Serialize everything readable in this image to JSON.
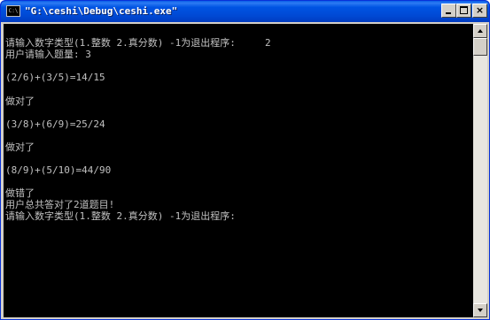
{
  "window": {
    "title": "\"G:\\ceshi\\Debug\\ceshi.exe\"",
    "icon_label": "C:\\",
    "icon": "console-app-icon"
  },
  "titlebar_buttons": {
    "minimize": "minimize-icon",
    "maximize": "maximize-icon",
    "close": "×"
  },
  "console": {
    "background": "#000000",
    "text_color": "#c0c0c0",
    "lines": [
      "请输入数字类型(1.整数 2.真分数) -1为退出程序:     2",
      "用户请输入题量: 3",
      "",
      "(2/6)+(3/5)=14/15",
      "",
      "做对了",
      "",
      "(3/8)+(6/9)=25/24",
      "",
      "做对了",
      "",
      "(8/9)+(5/10)=44/90",
      "",
      "做错了",
      "用户总共答对了2道题目!",
      "请输入数字类型(1.整数 2.真分数) -1为退出程序:"
    ]
  }
}
